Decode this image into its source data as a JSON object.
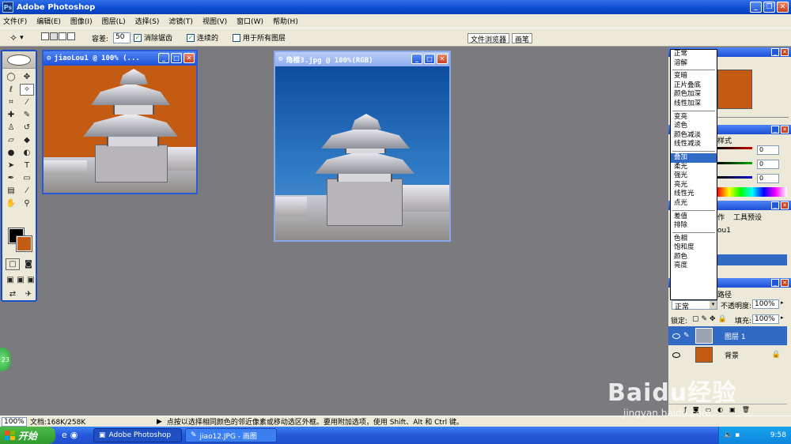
{
  "app": {
    "title": "Adobe Photoshop"
  },
  "menu": [
    "文件(F)",
    "编辑(E)",
    "图像(I)",
    "图层(L)",
    "选择(S)",
    "滤镜(T)",
    "视图(V)",
    "窗口(W)",
    "帮助(H)"
  ],
  "options": {
    "tolerance_label": "容差:",
    "tolerance_value": "50",
    "antialias_label": "消除锯齿",
    "contiguous_label": "连续的",
    "all_layers_label": "用于所有图层",
    "tab_file_browser": "文件浏览器",
    "tab_brushes": "画笔"
  },
  "windows": {
    "doc1_title": "jiaoLou1 @ 100% (...",
    "doc2_title": "角楼3.jpg @ 100%(RGB)"
  },
  "blend_modes": {
    "group1": [
      "正常",
      "溶解"
    ],
    "group2": [
      "变暗",
      "正片叠底",
      "颜色加深",
      "线性加深"
    ],
    "group3": [
      "变亮",
      "滤色",
      "颜色减淡",
      "线性减淡"
    ],
    "group4": [
      "叠加",
      "柔光",
      "强光",
      "亮光",
      "线性光",
      "点光"
    ],
    "group5": [
      "差值",
      "排除"
    ],
    "group6": [
      "色相",
      "饱和度",
      "颜色",
      "亮度"
    ],
    "selected": "叠加"
  },
  "panels": {
    "styles_tab": "样式",
    "color_values": [
      "0",
      "0",
      "0"
    ],
    "actions_tab": "作",
    "tool_presets_tab": "工具预设",
    "history_item": "ou1",
    "paths_tab": "路径",
    "blend_mode_value": "正常",
    "opacity_label": "不透明度:",
    "opacity_value": "100%",
    "lock_label": "锁定:",
    "fill_label": "填充:",
    "fill_value": "100%"
  },
  "layers": [
    {
      "name": "图层 1",
      "selected": true
    },
    {
      "name": "背景",
      "selected": false
    }
  ],
  "status": {
    "zoom": "100%",
    "doc_size": "文档:168K/258K",
    "hint": "点按以选择相同颜色的邻近像素或移动选区外框。要用附加选项，使用 Shift、Alt 和 Ctrl 键。"
  },
  "taskbar": {
    "start": "开始",
    "tasks": [
      "Adobe Photoshop",
      "jiao12.JPG - 画图"
    ],
    "time": "9:58"
  },
  "side_badge": "23",
  "watermark": {
    "brand": "Baidu经验",
    "url": "jingyan.baidu.com"
  },
  "colors": {
    "fg": "#000000",
    "bg": "#c35b13",
    "doc1_bg": "#c35b13",
    "doc2_sky": "#1e6ab4",
    "selection": "#316ac5"
  }
}
